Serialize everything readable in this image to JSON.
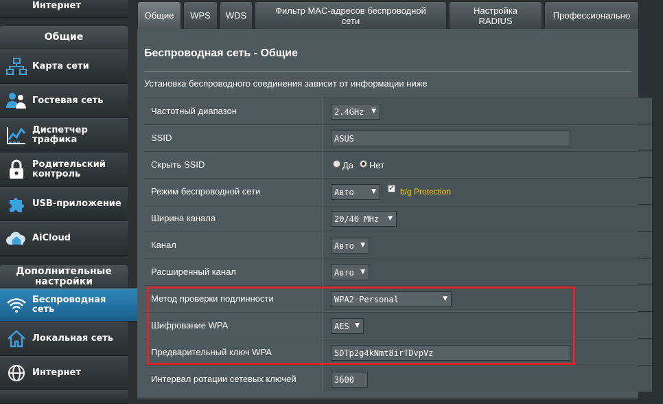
{
  "sidebar": {
    "top_item": {
      "label": "Интернет",
      "icon": "globe-icon"
    },
    "general_header": "Общие",
    "general_items": [
      {
        "label": "Карта сети",
        "icon": "network-map-icon"
      },
      {
        "label": "Гостевая сеть",
        "icon": "guest-network-icon"
      },
      {
        "label": "Диспетчер трафика",
        "icon": "traffic-manager-icon"
      },
      {
        "label": "Родительский контроль",
        "icon": "parental-control-icon"
      },
      {
        "label": "USB-приложение",
        "icon": "usb-puzzle-icon"
      },
      {
        "label": "AiCloud",
        "icon": "cloud-icon"
      }
    ],
    "advanced_header": "Дополнительные настройки",
    "advanced_items": [
      {
        "label": "Беспроводная сеть",
        "icon": "wifi-icon",
        "active": true
      },
      {
        "label": "Локальная сеть",
        "icon": "home-icon"
      },
      {
        "label": "Интернет",
        "icon": "globe-icon"
      }
    ]
  },
  "tabs": [
    {
      "label": "Общие",
      "active": true
    },
    {
      "label": "WPS"
    },
    {
      "label": "WDS"
    },
    {
      "label": "Фильтр MAC-адресов беспроводной сети"
    },
    {
      "label": "Настройка RADIUS"
    },
    {
      "label": "Профессионально"
    }
  ],
  "panel": {
    "title": "Беспроводная сеть - Общие",
    "description": "Установка беспроводного соединения зависит от информации ниже",
    "rows": {
      "band": {
        "label": "Частотный диапазон",
        "value": "2.4GHz"
      },
      "ssid": {
        "label": "SSID",
        "value": "ASUS"
      },
      "hide_ssid": {
        "label": "Скрыть SSID",
        "yes": "Да",
        "no": "Нет",
        "selected": "no"
      },
      "mode": {
        "label": "Режим беспроводной сети",
        "value": "Авто",
        "protection_label": "b/g Protection",
        "protection_checked": true
      },
      "width": {
        "label": "Ширина канала",
        "value": "20/40 MHz"
      },
      "channel": {
        "label": "Канал",
        "value": "Авто"
      },
      "ext_channel": {
        "label": "Расширенный канал",
        "value": "Авто"
      },
      "auth": {
        "label": "Метод проверки подлинности",
        "value": "WPA2-Personal"
      },
      "encryption": {
        "label": "Шифрование WPA",
        "value": "AES"
      },
      "psk": {
        "label": "Предварительный ключ WPA",
        "value": "SDTp2g4kNmt8irTDvpVz"
      },
      "rekey": {
        "label": "Интервал ротации сетевых ключей",
        "value": "3600"
      }
    }
  },
  "colors": {
    "accent_yellow": "#ffcc00",
    "highlight_red": "#d9262c",
    "active_blue": "#2e86b9"
  }
}
